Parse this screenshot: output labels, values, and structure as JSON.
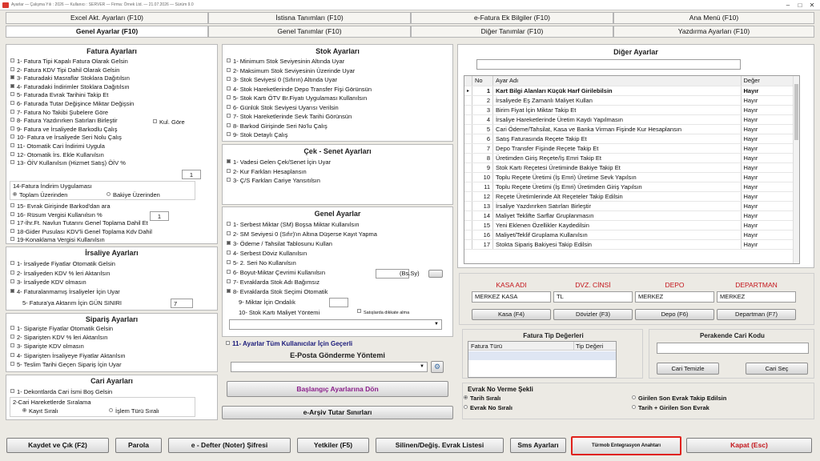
{
  "window": {
    "title": "Ayarlar — Çalışma Yılı : 2026 — Kullanıcı : SERVER — Firma: Örnek Ltd. — 21.07.2026 — Sürüm 9.0"
  },
  "tabs_row1": [
    "Excel Akt. Ayarları (F10)",
    "İstisna Tanımları (F10)",
    "e-Fatura Ek Bilgiler (F10)",
    "Ana Menü (F10)"
  ],
  "tabs_row2": [
    "Genel Ayarlar (F10)",
    "Genel Tanımlar (F10)",
    "Diğer Tanımlar (F10)",
    "Yazdırma Ayarları (F10)"
  ],
  "fatura": {
    "title": "Fatura Ayarları",
    "items": [
      {
        "label": "1- Fatura Tipi Kapalı Fatura Olarak Gelsin",
        "checked": false
      },
      {
        "label": "2- Fatura KDV Tipi Dahil Olarak Gelsin",
        "checked": false
      },
      {
        "label": "3- Faturadaki Masraflar Stoklara Dağıtılsın",
        "checked": true
      },
      {
        "label": "4- Faturadaki İndirimler Stoklara Dağıtılsın",
        "checked": true
      },
      {
        "label": "5- Faturada Evrak Tarihini Takip Et",
        "checked": false
      },
      {
        "label": "6- Faturada Tutar Değişince Miktar Değişsin",
        "checked": false
      },
      {
        "label": "7- Fatura No Takibi Şubelere Göre",
        "checked": false
      },
      {
        "label": "8- Fatura Yazdırırken Satırları Birleştir",
        "checked": false
      },
      {
        "label": "9- Fatura ve İrsaliyede Barkodlu Çalış",
        "checked": false
      },
      {
        "label": "10- Fatura ve İrsaliyede Seri Nolu Çalış",
        "checked": false
      },
      {
        "label": "11- Otomatik Cari İndirimi Uygula",
        "checked": false
      },
      {
        "label": "12- Otomatik İrs. Ekle Kullanılsın",
        "checked": false
      },
      {
        "label": "13- ÖİV Kullanılsın (Hizmet Satış) ÖİV %",
        "checked": false
      }
    ],
    "kul_gore": "Kul. Göre",
    "oiv_value": "1",
    "indirim_group": "14-Fatura İndirim Uygulaması",
    "radio_toplam": "Toplam Üzerinden",
    "radio_bakiye": "Bakiye Üzerinden",
    "items2": [
      {
        "label": "15- Evrak Girişinde Barkod'dan ara",
        "checked": false
      },
      {
        "label": "16- Rüsum Vergisi Kullanılsın %",
        "checked": false
      },
      {
        "label": "17-İhr.Ft. Navlun Tutarını Genel Toplama Dahil Et",
        "checked": false
      },
      {
        "label": "18-Gider Pusulası KDV'li Genel Toplama Kdv Dahil",
        "checked": false
      },
      {
        "label": "19-Konaklama Vergisi Kullanılsın",
        "checked": false
      }
    ],
    "rusum_value": "1"
  },
  "irsaliye": {
    "title": "İrsaliye Ayarları",
    "items": [
      {
        "label": "1- İrsaliyede Fiyatlar Otomatik Gelsin",
        "checked": false
      },
      {
        "label": "2- İrsaliyeden KDV % leri Aktarılsın",
        "checked": false
      },
      {
        "label": "3- İrsaliyede KDV olmasın",
        "checked": false
      },
      {
        "label": "4- Faturalanmamış İrsaliyeler İçin Uyar",
        "checked": true
      }
    ],
    "gun_label": "5- Fatura'ya Aktarım İçin GÜN SINIRI",
    "gun_value": "7"
  },
  "siparis": {
    "title": "Sipariş Ayarları",
    "items": [
      {
        "label": "1- Siparişte Fiyatlar Otomatik Gelsin",
        "checked": false
      },
      {
        "label": "2- Siparişten KDV % leri Aktarılsın",
        "checked": false
      },
      {
        "label": "3- Siparişte KDV olmasın",
        "checked": false
      },
      {
        "label": "4- Siparişten İrsaliyeye Fiyatlar Aktarılsın",
        "checked": false
      },
      {
        "label": "5- Teslim Tarihi Geçen Sipariş İçin Uyar",
        "checked": false
      }
    ]
  },
  "cari": {
    "title": "Cari Ayarları",
    "item1": "1- Dekontlarda Cari İsmi Boş Gelsin",
    "group": "2-Cari Hareketlerde Sıralama",
    "radio_kayit": "Kayıt Sıralı",
    "radio_islem": "İşlem Türü Sıralı"
  },
  "stok": {
    "title": "Stok Ayarları",
    "items": [
      {
        "label": "1- Minimum Stok Seviyesinin Altında Uyar",
        "checked": false
      },
      {
        "label": "2- Maksimum Stok Seviyesinin Üzerinde Uyar",
        "checked": false
      },
      {
        "label": "3- Stok Seviyesi 0 (Sıfırın) Altında Uyar",
        "checked": false
      },
      {
        "label": "4- Stok Hareketlerinde Depo Transfer Fişi Görünsün",
        "checked": false
      },
      {
        "label": "5- Stok Kartı ÖTV Br.Fiyatı Uygulaması Kullanılsın",
        "checked": false
      },
      {
        "label": "6- Günlük Stok Seviyesi Uyarısı Verilsin",
        "checked": false
      },
      {
        "label": "7- Stok Hareketlerinde Sevk Tarihi Görünsün",
        "checked": false
      },
      {
        "label": "8- Barkod Girişinde Seri No'lu Çalış",
        "checked": false
      },
      {
        "label": "9- Stok Detaylı Çalış",
        "checked": false
      }
    ]
  },
  "cek": {
    "title": "Çek - Senet Ayarları",
    "items": [
      {
        "label": "1- Vadesi Gelen Çek/Senet İçin Uyar",
        "checked": true
      },
      {
        "label": "2- Kur Farkları Hesaplansın",
        "checked": false
      },
      {
        "label": "3- Ç/S Farkları Cariye Yansıtılsın",
        "checked": false
      }
    ]
  },
  "genel": {
    "title": "Genel Ayarlar",
    "items": [
      {
        "label": "1- Serbest Miktar (SM) Boşsa Miktar Kullanılsın",
        "checked": false
      },
      {
        "label": "2- SM Seviyesi 0 (Sıfır)'ın Altına Düşerse Kayıt Yapma",
        "checked": false
      },
      {
        "label": "3- Ödeme / Tahsilat Tablosunu Kullan",
        "checked": true
      },
      {
        "label": "4- Serbest Döviz Kullanılsın",
        "checked": false
      },
      {
        "label": "5- 2. Seri No Kullanılsın",
        "checked": false
      },
      {
        "label": "6- Boyut-Miktar Çevrimi Kullanılsın",
        "checked": false
      },
      {
        "label": "7- Evraklarda Stok Adı Bağımsız",
        "checked": false
      },
      {
        "label": "8- Evraklarda Stok Seçimi Otomatik",
        "checked": true
      }
    ],
    "bs_label": "(Bs.Sy)",
    "ondalik_label": "9- Miktar İçin Ondalık",
    "maliyet_label": "10- Stok Kartı Maliyet Yöntemi",
    "dikkate_label": "Satışlarda dikkate alma",
    "item11": "11- Ayarlar Tüm Kullanıcılar İçin Geçerli"
  },
  "eposta": {
    "title": "E-Posta Gönderme Yöntemi"
  },
  "baslangic_button": "Başlangıç Ayarlarına Dön",
  "earsiv_button": "e-Arşiv Tutar Sınırları",
  "diger": {
    "title": "Diğer Ayarlar",
    "col_no": "No",
    "col_ad": "Ayar Adı",
    "col_deger": "Değer",
    "rows": [
      {
        "no": "1",
        "ad": "Kart Bilgi Alanları Küçük Harf Girilebilsin",
        "deger": "Hayır"
      },
      {
        "no": "2",
        "ad": "İrsaliyede Eş Zamanlı Maliyet Kullan",
        "deger": "Hayır"
      },
      {
        "no": "3",
        "ad": "Birim Fiyat İçin Miktar Takip Et",
        "deger": "Hayır"
      },
      {
        "no": "4",
        "ad": "İrsaliye Hareketlerinde Üretim Kaydı Yapılmasın",
        "deger": "Hayır"
      },
      {
        "no": "5",
        "ad": "Cari Ödeme/Tahsilat, Kasa ve Banka Virman Fişinde Kur Hesaplansın",
        "deger": "Hayır"
      },
      {
        "no": "6",
        "ad": "Satış Faturasında Reçete Takip Et",
        "deger": "Hayır"
      },
      {
        "no": "7",
        "ad": "Depo Transfer Fişinde Reçete Takip Et",
        "deger": "Hayır"
      },
      {
        "no": "8",
        "ad": "Üretimden Giriş Reçete/İş Emri Takip Et",
        "deger": "Hayır"
      },
      {
        "no": "9",
        "ad": "Stok Kartı Reçetesi Üretiminde Bakiye Takip Et",
        "deger": "Hayır"
      },
      {
        "no": "10",
        "ad": "Toplu Reçete Üretimi (İş Emri) Üretime Sevk Yapılsın",
        "deger": "Hayır"
      },
      {
        "no": "11",
        "ad": "Toplu Reçete Üretimi (İş Emri) Üretimden Giriş Yapılsın",
        "deger": "Hayır"
      },
      {
        "no": "12",
        "ad": "Reçete Üretimlerinde Alt Reçeteler Takip Edilsin",
        "deger": "Hayır"
      },
      {
        "no": "13",
        "ad": "İrsaliye Yazdırırken Satırları Birleştir",
        "deger": "Hayır"
      },
      {
        "no": "14",
        "ad": "Maliyet Teklifte Sarflar Gruplanmasın",
        "deger": "Hayır"
      },
      {
        "no": "15",
        "ad": "Yeni Eklenen Özellikler Kaydedilsin",
        "deger": "Hayır"
      },
      {
        "no": "16",
        "ad": "Maliyet/Teklif Gruplama Kullanılsın",
        "deger": "Hayır"
      },
      {
        "no": "17",
        "ad": "Stokta Sipariş Bakiyesi Takip Edilsin",
        "deger": "Hayır"
      }
    ]
  },
  "defaults": {
    "kasa_label": "KASA ADI",
    "doviz_label": "DVZ. CİNSİ",
    "depo_label": "DEPO",
    "departman_label": "DEPARTMAN",
    "kasa_value": "MERKEZ KASA",
    "doviz_value": "TL",
    "depo_value": "MERKEZ",
    "departman_value": "MERKEZ",
    "kasa_btn": "Kasa (F4)",
    "doviz_btn": "Dövizler (F3)",
    "depo_btn": "Depo (F6)",
    "departman_btn": "Departman (F7)"
  },
  "fatura_tip": {
    "title": "Fatura Tip Değerleri",
    "col1": "Fatura Türü",
    "col2": "Tip Değeri"
  },
  "perakende": {
    "title": "Perakende Cari Kodu",
    "temizle": "Cari Temizle",
    "sec": "Cari Seç"
  },
  "evrak_no": {
    "title": "Evrak No Verme Şekli",
    "options": [
      "Tarih Sıralı",
      "Evrak No Sıralı",
      "Girilen Son Evrak Takip Edilsin",
      "Tarih + Girilen Son Evrak"
    ]
  },
  "bottom": [
    "Kaydet ve Çık (F2)",
    "Parola",
    "e - Defter (Noter) Şifresi",
    "Yetkiler (F5)",
    "Silinen/Değiş. Evrak Listesi",
    "Sms Ayarları",
    "Türmob Entegrasyon Anahtarı",
    "Kapat (Esc)"
  ],
  "colors": {
    "highlight": "#e0221c",
    "accent_red": "#c4161c"
  }
}
